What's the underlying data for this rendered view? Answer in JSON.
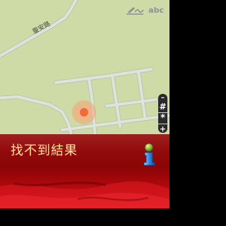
{
  "status_bar": {
    "input_mode": "abc",
    "input_mode_icon": "handwriting-pen-icon"
  },
  "map": {
    "street_label": "靈安路",
    "location_marker_icon": "current-location-marker-icon",
    "colors": {
      "land": "#cedba7",
      "road": "#dfe3dd",
      "road_edge": "#bcc6a6",
      "marker_core": "#f26a3a",
      "marker_halo": "#f4a26f"
    }
  },
  "zoom_control": {
    "zoom_out": "–",
    "hash_key": "#",
    "star_key": "*",
    "zoom_in": "+"
  },
  "result_panel": {
    "message": "找不到結果",
    "info_icon": "info-icon",
    "colors": {
      "panel_red": "#8b0405",
      "panel_bright_red": "#d51219",
      "message_text": "#ffe39a"
    }
  }
}
